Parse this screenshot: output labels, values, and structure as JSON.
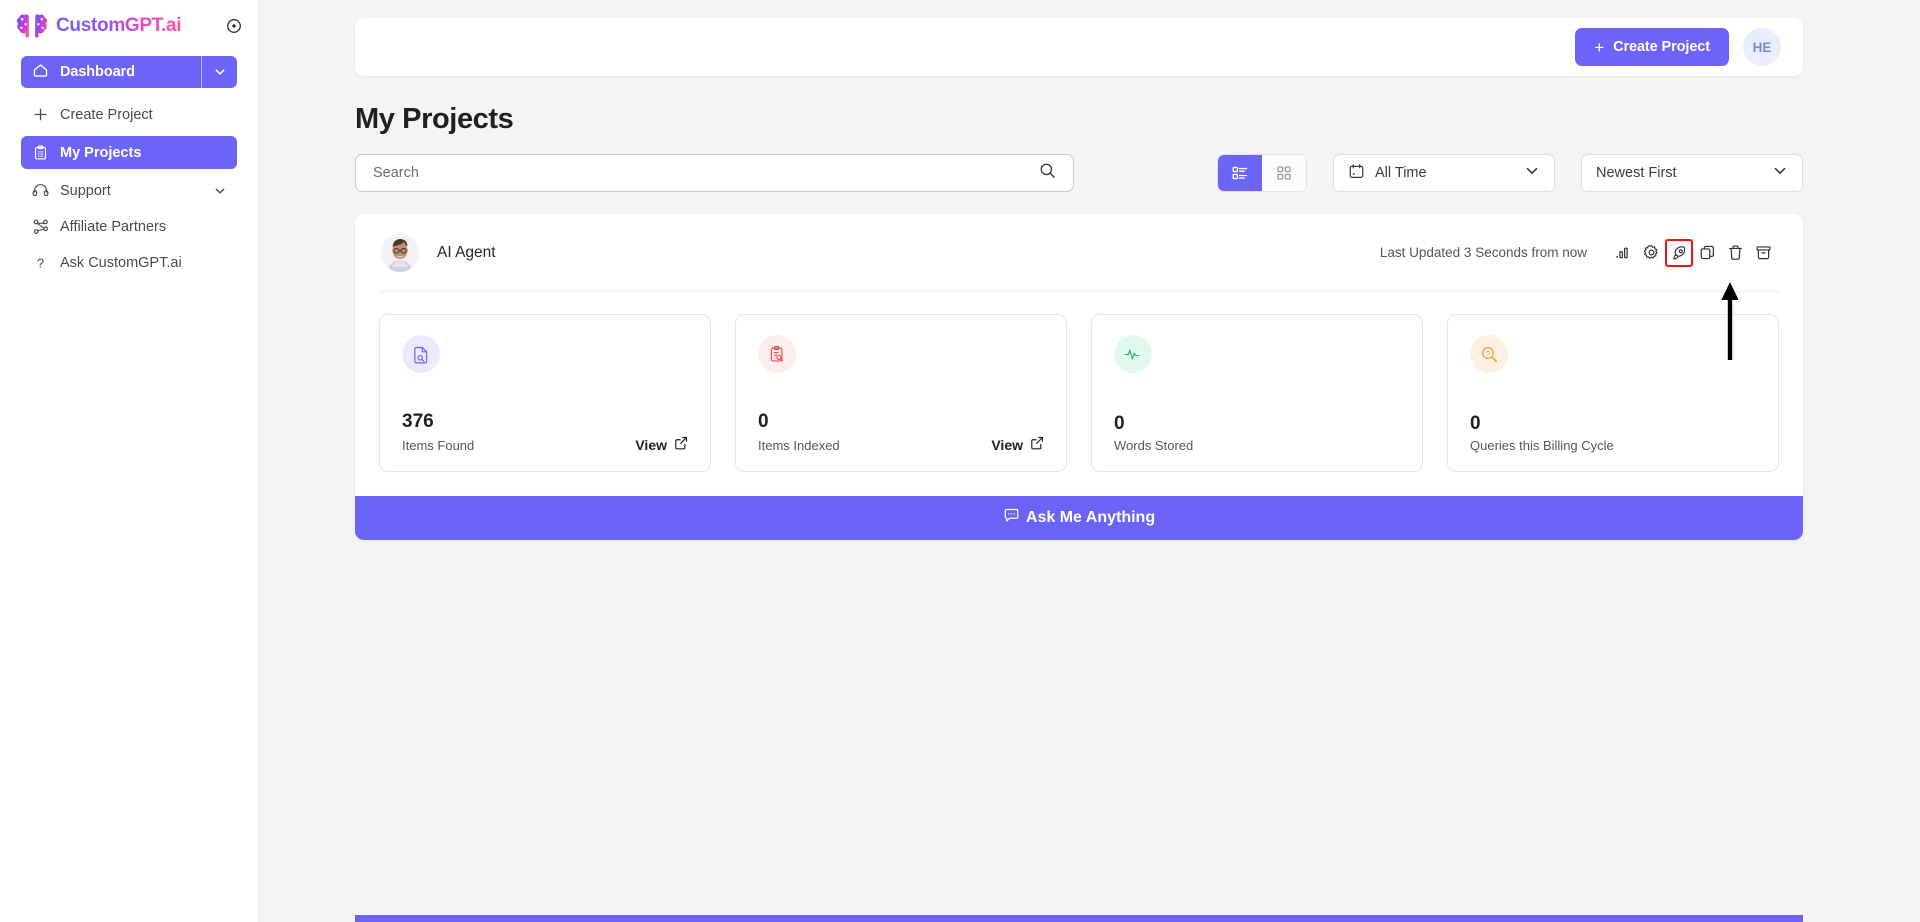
{
  "sidebar": {
    "logo_text": "CustomGPT.ai",
    "collapse_icon": "circle-dot-icon",
    "dashboard": {
      "label": "Dashboard",
      "icon": "home-icon",
      "caret": "chevron-down-icon"
    },
    "items": [
      {
        "label": "Create Project",
        "icon": "plus-icon",
        "active": false,
        "caret": ""
      },
      {
        "label": "My Projects",
        "icon": "clipboard-icon",
        "active": true,
        "caret": ""
      },
      {
        "label": "Support",
        "icon": "headset-icon",
        "active": false,
        "caret": "chevron-down-icon"
      },
      {
        "label": "Affiliate Partners",
        "icon": "share-nodes-icon",
        "active": false,
        "caret": ""
      },
      {
        "label": "Ask CustomGPT.ai",
        "icon": "question-mark-icon",
        "active": false,
        "caret": ""
      }
    ]
  },
  "topbar": {
    "create_project_label": "Create Project",
    "create_project_plus": "+",
    "avatar_initials": "HE"
  },
  "page": {
    "title": "My Projects"
  },
  "search": {
    "placeholder": "Search",
    "value": "",
    "icon": "search-icon"
  },
  "view_toggle": {
    "list_icon": "list-view-icon",
    "grid_icon": "grid-view-icon",
    "selected": "list"
  },
  "filters": {
    "date": {
      "label": "All Time",
      "icon": "calendar-icon",
      "caret": "chevron-down-icon"
    },
    "sort": {
      "label": "Newest First",
      "caret": "chevron-down-icon"
    }
  },
  "project": {
    "name": "AI Agent",
    "avatar": "user-photo-avatar",
    "last_updated": "Last Updated 3 Seconds from now",
    "actions": [
      {
        "name": "analytics-bar-chart-icon",
        "highlighted": false
      },
      {
        "name": "settings-gear-icon",
        "highlighted": false
      },
      {
        "name": "rocket-deploy-icon",
        "highlighted": true
      },
      {
        "name": "duplicate-copy-icon",
        "highlighted": false
      },
      {
        "name": "delete-trash-icon",
        "highlighted": false
      },
      {
        "name": "archive-box-icon",
        "highlighted": false
      }
    ],
    "stats": [
      {
        "value": "376",
        "label": "Items Found",
        "icon": "file-search-icon",
        "icon_color": "#6c63f7",
        "bg_color": "#ebe9fd",
        "view_label": "View",
        "has_view": true
      },
      {
        "value": "0",
        "label": "Items Indexed",
        "icon": "clipboard-search-icon",
        "icon_color": "#ef5350",
        "bg_color": "#fdecec",
        "view_label": "View",
        "has_view": true
      },
      {
        "value": "0",
        "label": "Words Stored",
        "icon": "activity-pulse-icon",
        "icon_color": "#27b86a",
        "bg_color": "#e3f8ec",
        "view_label": "",
        "has_view": false
      },
      {
        "value": "0",
        "label": "Queries this Billing Cycle",
        "icon": "search-question-icon",
        "icon_color": "#f5952b",
        "bg_color": "#fdf0e0",
        "view_label": "",
        "has_view": false
      }
    ],
    "ask_me_anything": {
      "label": "Ask Me Anything",
      "icon": "chat-bubble-icon"
    }
  },
  "colors": {
    "accent": "#6c63f7",
    "highlight_box": "#f01414",
    "page_bg": "#f4f4f5"
  }
}
